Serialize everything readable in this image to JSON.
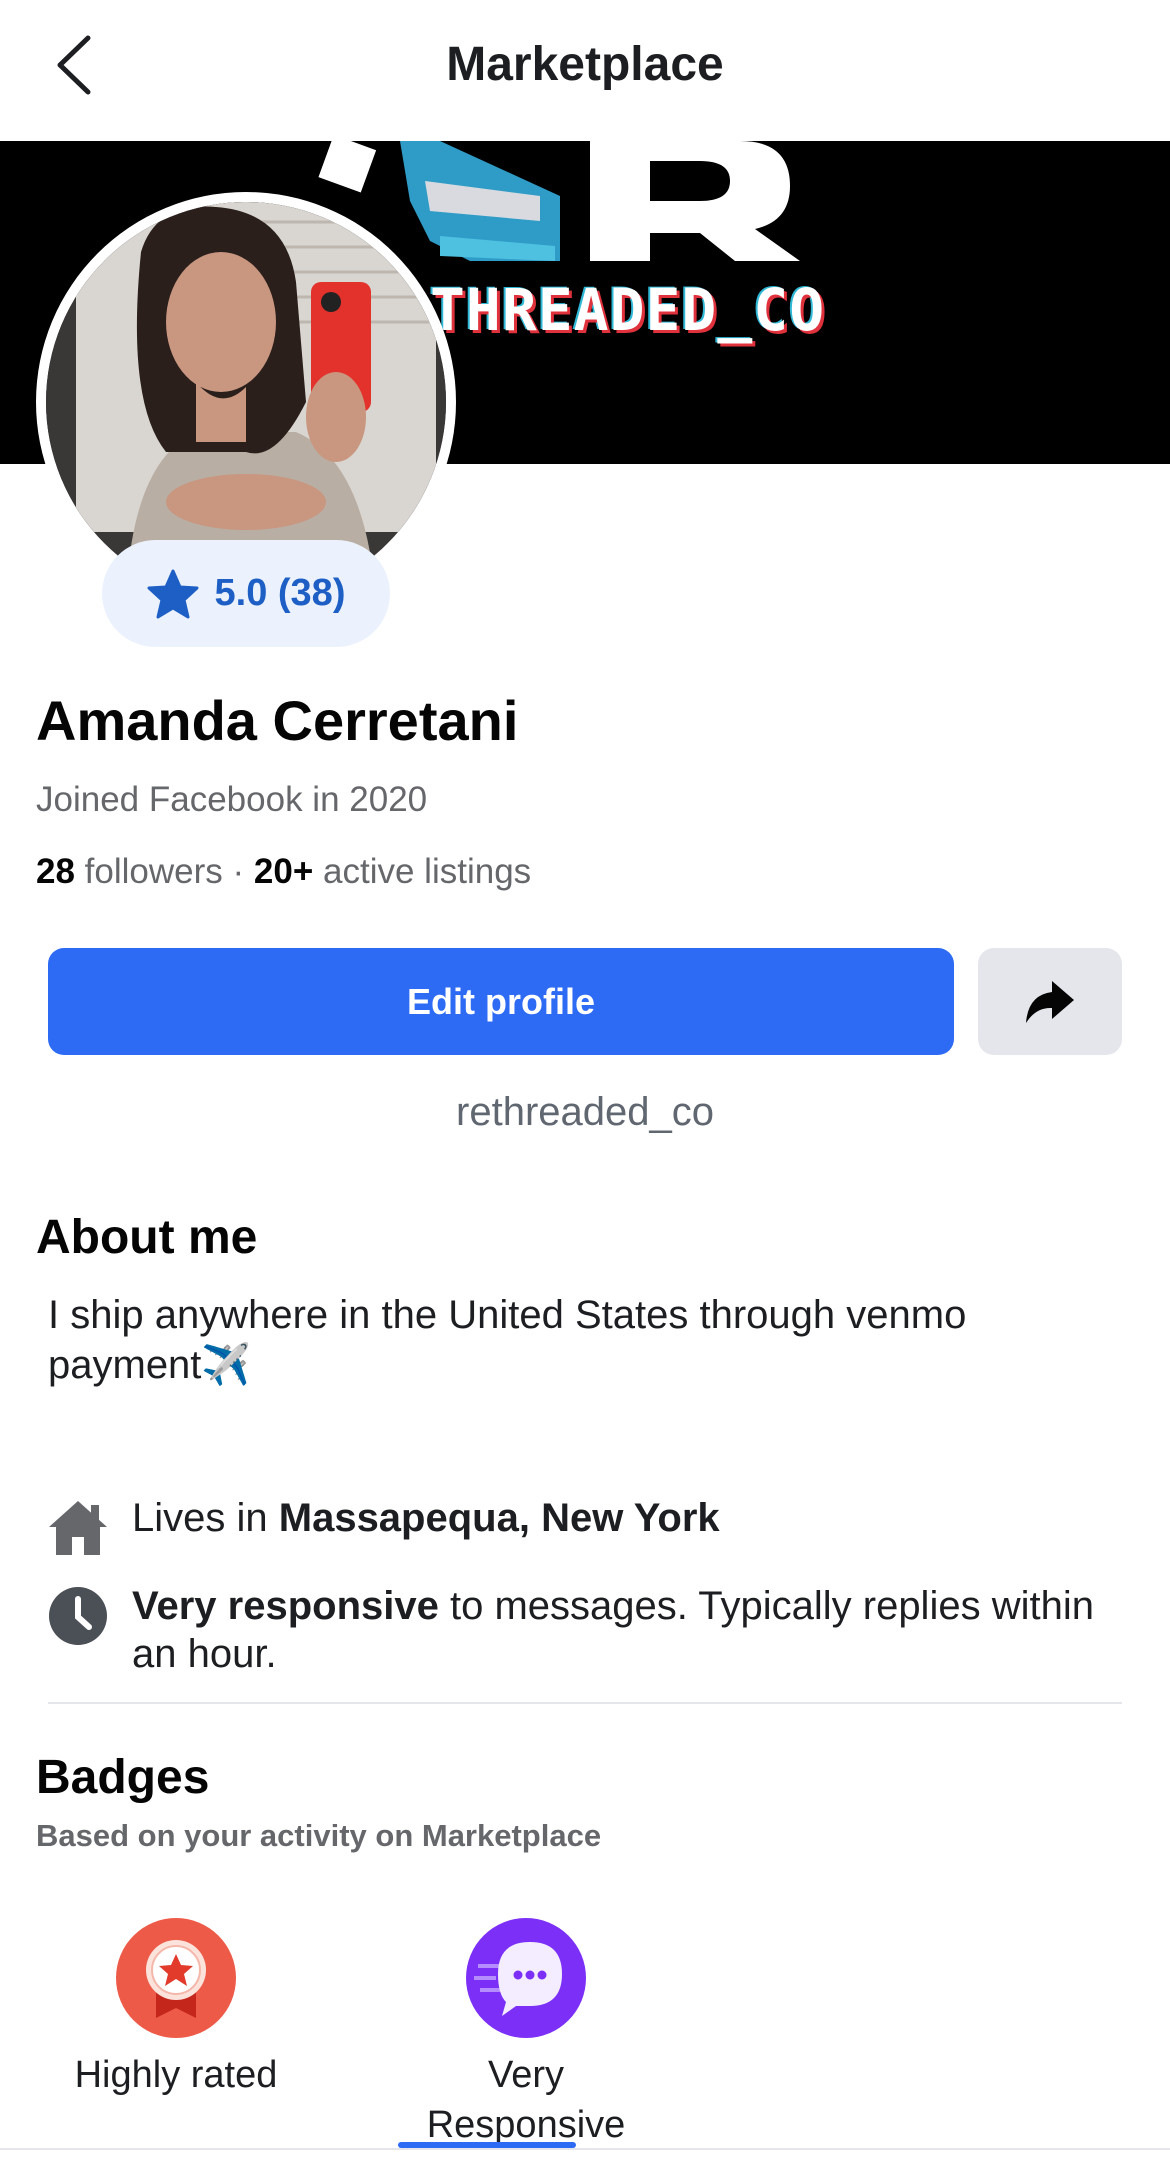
{
  "header": {
    "title": "Marketplace"
  },
  "cover": {
    "text": "THREADED_CO"
  },
  "profile": {
    "rating": "5.0 (38)",
    "name": "Amanda Cerretani",
    "joined": "Joined Facebook in 2020",
    "followers_count": "28",
    "followers_label": "followers",
    "separator": "·",
    "listings_count": "20+",
    "listings_label": "active listings",
    "edit_label": "Edit profile",
    "username": "rethreaded_co"
  },
  "about": {
    "heading": "About me",
    "text": "I ship anywhere in the United States through venmo payment✈️"
  },
  "info": {
    "lives_prefix": "Lives in ",
    "location": "Massapequa, New York",
    "responsive_bold": "Very responsive",
    "responsive_rest": " to messages. Typically replies within an hour."
  },
  "badges": {
    "heading": "Badges",
    "subtitle": "Based on your activity on Marketplace",
    "items": [
      {
        "label": "Highly rated",
        "icon": "award-ribbon-icon",
        "color": "#ee5a48"
      },
      {
        "label": "Very Responsive",
        "icon": "chat-bubble-icon",
        "color": "#7b2ff7"
      }
    ]
  },
  "colors": {
    "accent": "#2d6bf5",
    "rating_text": "#1d5fc4",
    "rating_bg": "#ebf2fd"
  }
}
